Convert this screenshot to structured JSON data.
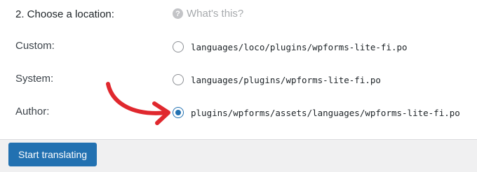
{
  "section": {
    "heading": "2. Choose a location:",
    "help_label": "What's this?",
    "help_icon": "question-circle-icon"
  },
  "locations": [
    {
      "label": "Custom:",
      "path": "languages/loco/plugins/wpforms-lite-fi.po",
      "checked": false
    },
    {
      "label": "System:",
      "path": "languages/plugins/wpforms-lite-fi.po",
      "checked": false
    },
    {
      "label": "Author:",
      "path": "plugins/wpforms/assets/languages/wpforms-lite-fi.po",
      "checked": true
    }
  ],
  "actions": {
    "start_label": "Start translating"
  },
  "colors": {
    "accent": "#2271b1",
    "annotation_arrow": "#e0282e"
  }
}
